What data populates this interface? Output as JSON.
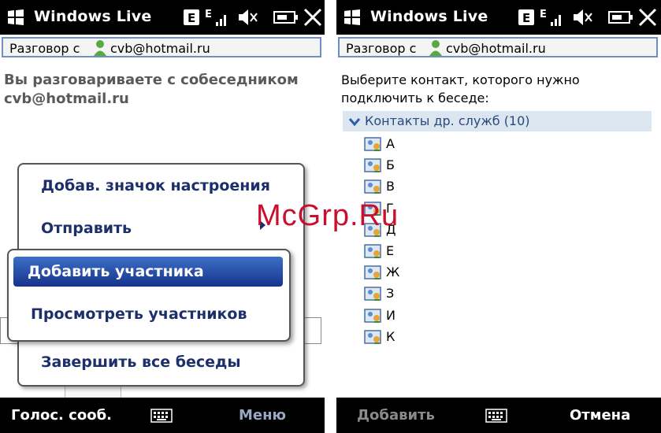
{
  "left_screen": {
    "title": "Windows Live",
    "conversation": {
      "label": "Разговор с",
      "contact": "cvb@hotmail.ru"
    },
    "info_text": "Вы разговариваете с собеседником cvb@hotmail.ru",
    "menu": {
      "items": [
        "Добав. значок настроения",
        "Отправить",
        "Завершить все беседы"
      ],
      "submenu": [
        "Добавить участника",
        "Просмотреть участников"
      ]
    },
    "softkeys": {
      "left": "Голос. сооб.",
      "right": "Меню"
    }
  },
  "right_screen": {
    "title": "Windows Live",
    "conversation": {
      "label": "Разговор с",
      "contact": "cvb@hotmail.ru"
    },
    "prompt": "Выберите контакт, которого нужно подключить к беседе:",
    "group": "Контакты др. служб (10)",
    "contacts": [
      "А",
      "Б",
      "В",
      "Г",
      "Д",
      "Е",
      "Ж",
      "З",
      "И",
      "К"
    ],
    "softkeys": {
      "left": "Добавить",
      "right": "Отмена"
    }
  },
  "status_icons": [
    "windows-flag-icon",
    "edge-icon",
    "signal-icon",
    "speaker-muted-icon",
    "battery-charging-icon",
    "close-icon"
  ],
  "watermark": "McGrp.Ru",
  "colors": {
    "titlebar": "#000000",
    "selection": "#1f4aa8",
    "menu_text": "#1c2f6b",
    "group_bg": "#dbe6f1",
    "watermark": "#c8102e"
  }
}
